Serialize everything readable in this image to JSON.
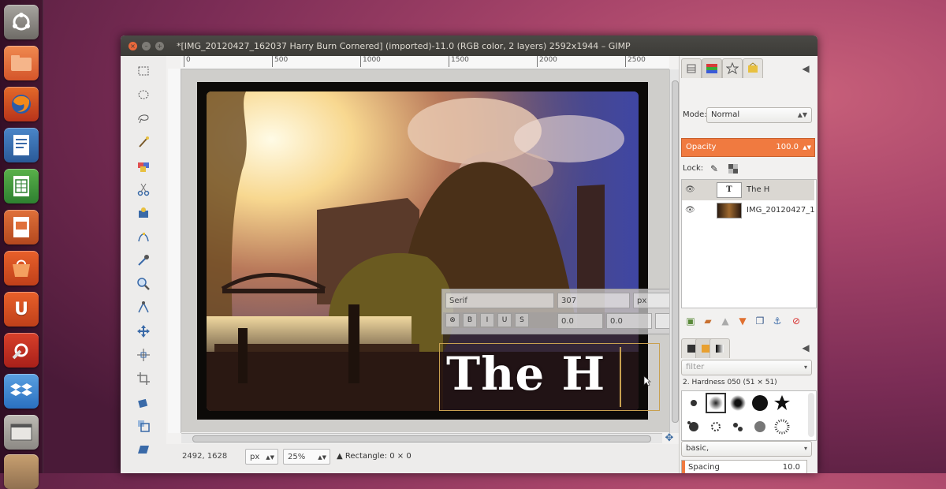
{
  "window": {
    "title": "*[IMG_20120427_162037 Harry Burn Cornered] (imported)-11.0 (RGB color, 2 layers) 2592x1944 – GIMP",
    "close": "×",
    "minimize": "–",
    "maximize": "+"
  },
  "launcher": {
    "icons": [
      "ubuntu-icon",
      "files-icon",
      "firefox-icon",
      "writer-icon",
      "calc-icon",
      "impress-icon",
      "software-center-icon",
      "ubuntu-one-icon",
      "system-settings-icon",
      "dropbox-icon",
      "workspace-icon",
      "gimp-icon"
    ],
    "ubuntu_one_letter": "U"
  },
  "ruler": {
    "marks": [
      "0",
      "500",
      "1000",
      "1500",
      "2000",
      "2500"
    ]
  },
  "text_toolbar": {
    "font": "Serif",
    "size": "307",
    "unit": "px",
    "baseline": "0.0",
    "kerning": "0.0"
  },
  "canvas": {
    "text_layer": "The H"
  },
  "statusbar": {
    "coords": "2492, 1628",
    "unit": "px",
    "zoom": "25%",
    "message": "Rectangle: 0 × 0"
  },
  "dock": {
    "mode_label": "Mode:",
    "mode_value": "Normal",
    "opacity_label": "Opacity",
    "opacity_value": "100.0",
    "lock_label": "Lock:",
    "layers": [
      {
        "name": "The H",
        "thumb": "T"
      },
      {
        "name": "IMG_20120427_1",
        "thumb": ""
      }
    ],
    "brush_filter": "filter",
    "brush_name": "2. Hardness 050 (51 × 51)",
    "brush_tag": "basic,",
    "spacing_label": "Spacing",
    "spacing_value": "10.0"
  },
  "colors": {
    "accent": "#f07a40",
    "titlebar": "#3c3b37",
    "close_button": "#e9683b"
  }
}
